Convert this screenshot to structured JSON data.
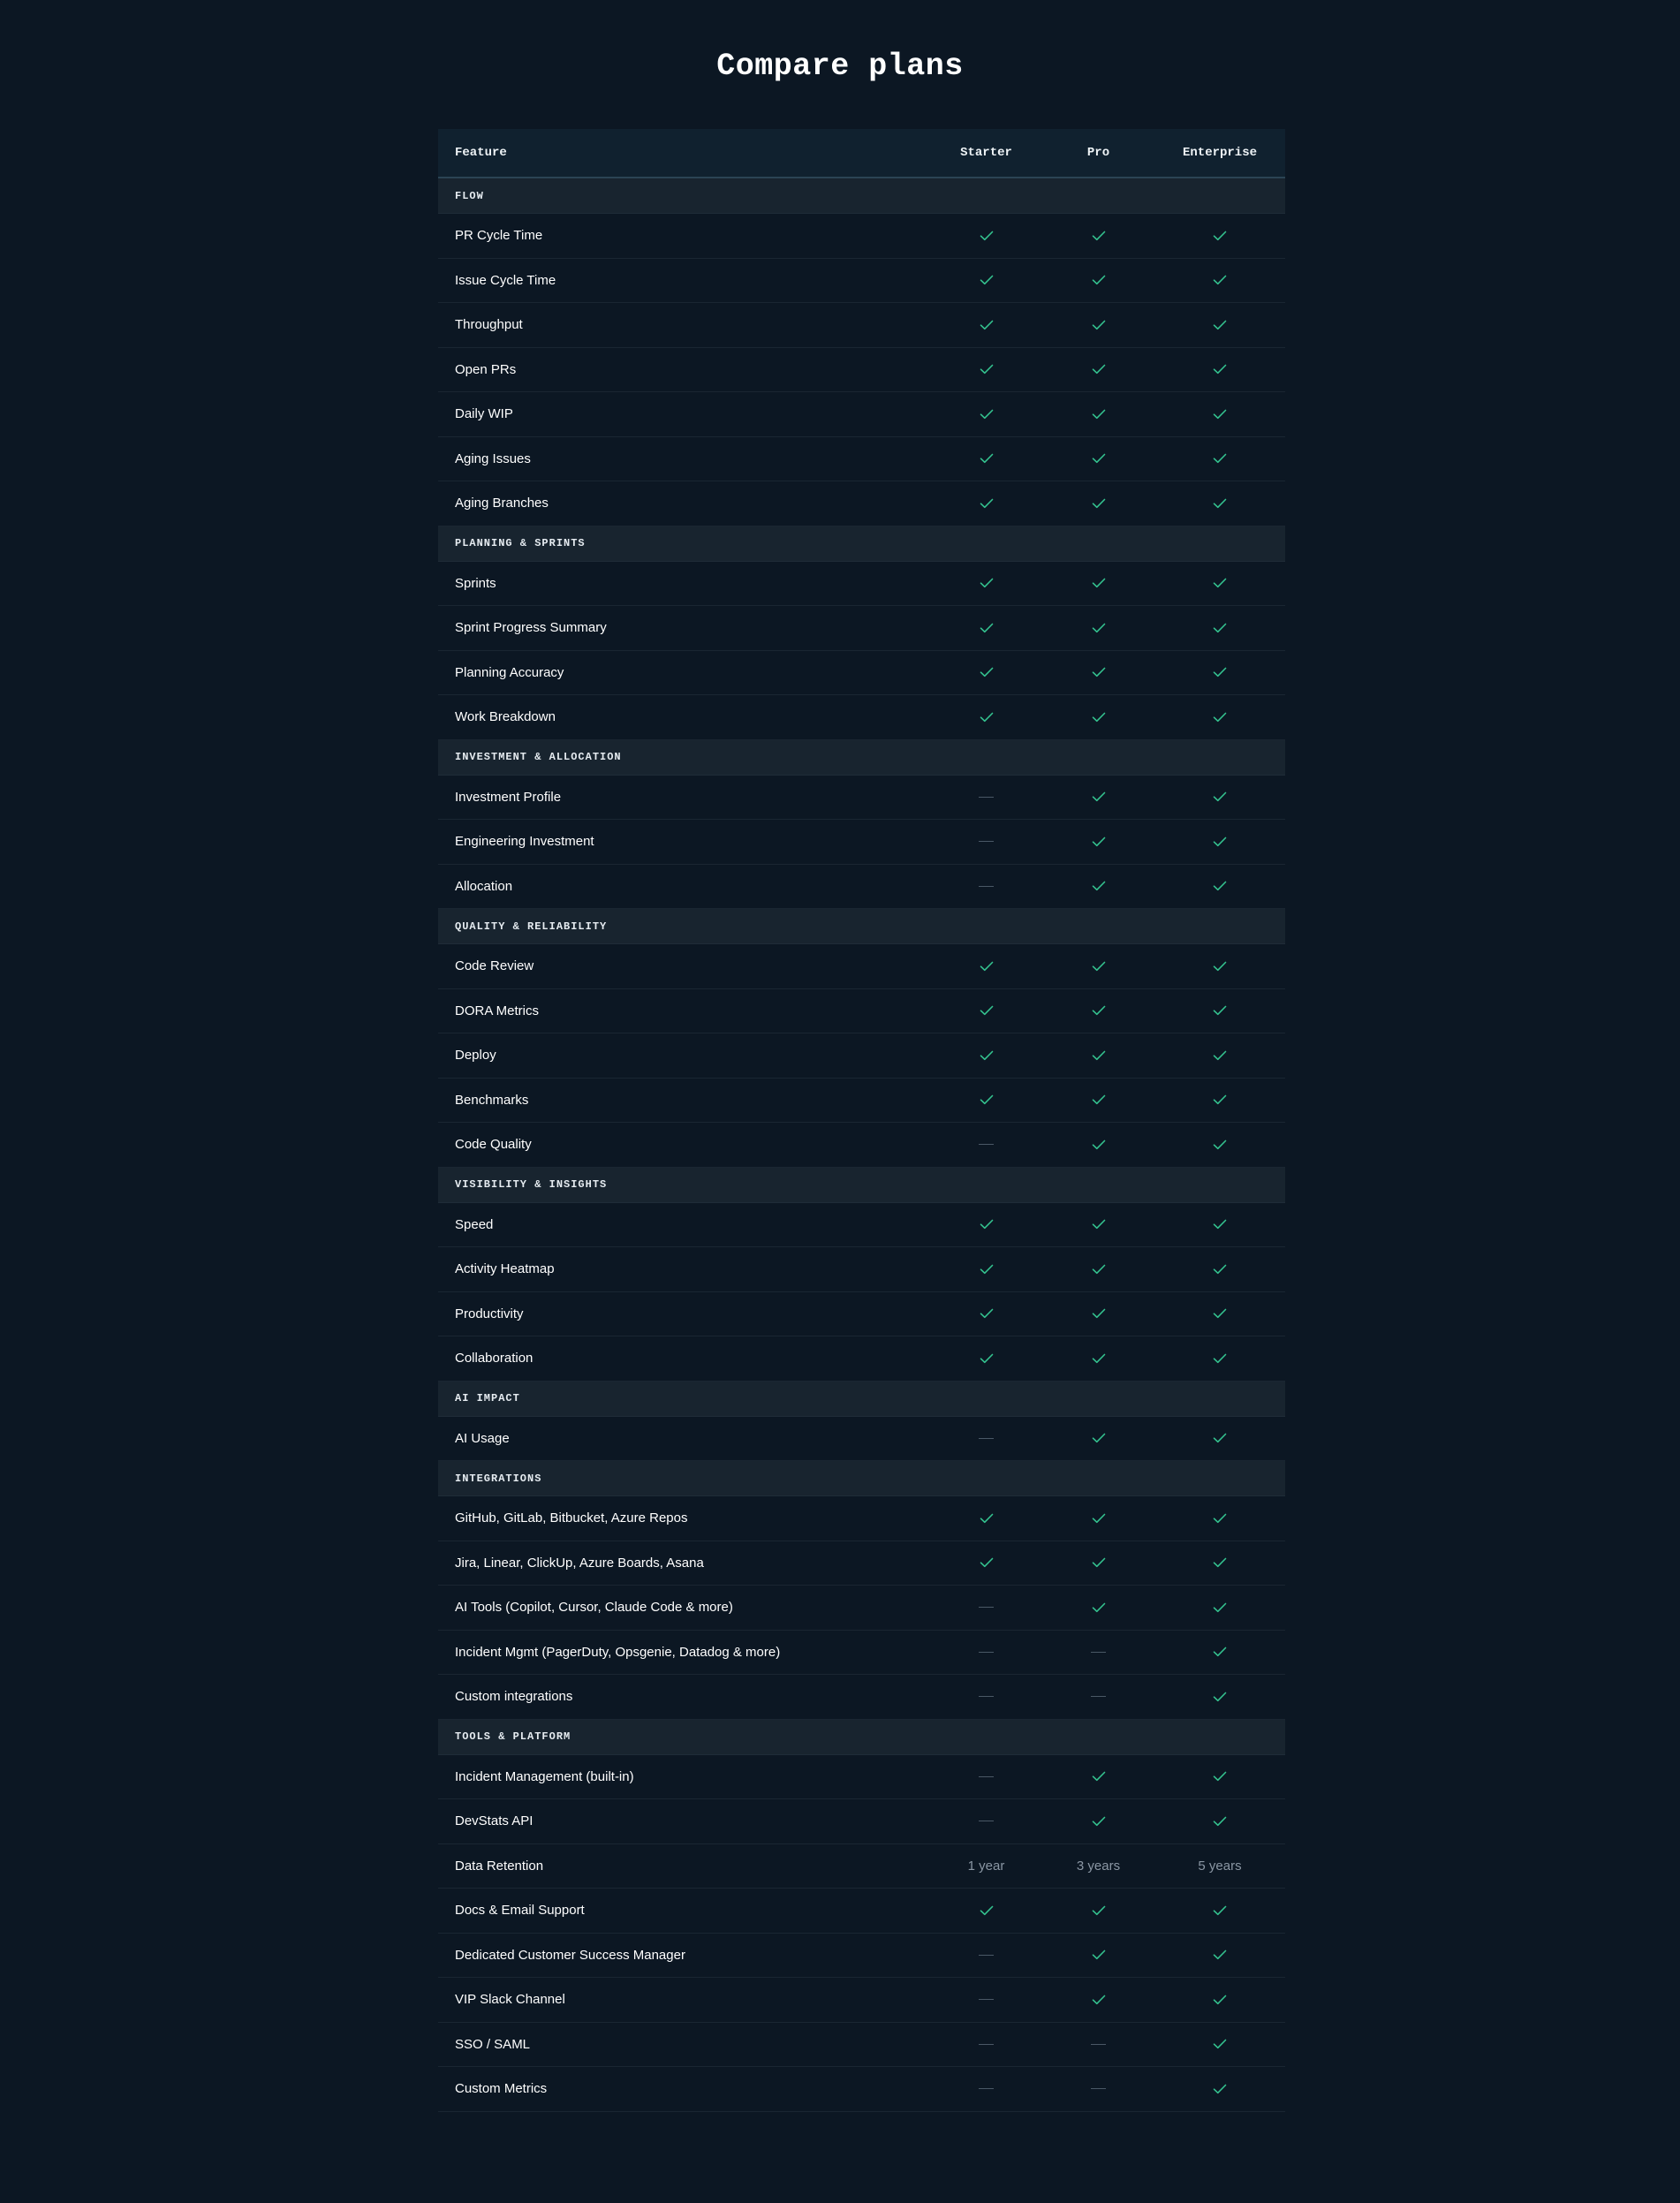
{
  "title": "Compare plans",
  "colors": {
    "background": "#0c1723",
    "header_bg": "#10212f",
    "section_bg": "#18242f",
    "check": "#34c28f",
    "dash": "#4a5866",
    "muted_text": "#8a96a3"
  },
  "columns": [
    "Feature",
    "Starter",
    "Pro",
    "Enterprise"
  ],
  "sections": [
    {
      "name": "FLOW",
      "rows": [
        {
          "feature": "PR Cycle Time",
          "values": [
            "check",
            "check",
            "check"
          ]
        },
        {
          "feature": "Issue Cycle Time",
          "values": [
            "check",
            "check",
            "check"
          ]
        },
        {
          "feature": "Throughput",
          "values": [
            "check",
            "check",
            "check"
          ]
        },
        {
          "feature": "Open PRs",
          "values": [
            "check",
            "check",
            "check"
          ]
        },
        {
          "feature": "Daily WIP",
          "values": [
            "check",
            "check",
            "check"
          ]
        },
        {
          "feature": "Aging Issues",
          "values": [
            "check",
            "check",
            "check"
          ]
        },
        {
          "feature": "Aging Branches",
          "values": [
            "check",
            "check",
            "check"
          ]
        }
      ]
    },
    {
      "name": "PLANNING & SPRINTS",
      "rows": [
        {
          "feature": "Sprints",
          "values": [
            "check",
            "check",
            "check"
          ]
        },
        {
          "feature": "Sprint Progress Summary",
          "values": [
            "check",
            "check",
            "check"
          ]
        },
        {
          "feature": "Planning Accuracy",
          "values": [
            "check",
            "check",
            "check"
          ]
        },
        {
          "feature": "Work Breakdown",
          "values": [
            "check",
            "check",
            "check"
          ]
        }
      ]
    },
    {
      "name": "INVESTMENT & ALLOCATION",
      "rows": [
        {
          "feature": "Investment Profile",
          "values": [
            "dash",
            "check",
            "check"
          ]
        },
        {
          "feature": "Engineering Investment",
          "values": [
            "dash",
            "check",
            "check"
          ]
        },
        {
          "feature": "Allocation",
          "values": [
            "dash",
            "check",
            "check"
          ]
        }
      ]
    },
    {
      "name": "QUALITY & RELIABILITY",
      "rows": [
        {
          "feature": "Code Review",
          "values": [
            "check",
            "check",
            "check"
          ]
        },
        {
          "feature": "DORA Metrics",
          "values": [
            "check",
            "check",
            "check"
          ]
        },
        {
          "feature": "Deploy",
          "values": [
            "check",
            "check",
            "check"
          ]
        },
        {
          "feature": "Benchmarks",
          "values": [
            "check",
            "check",
            "check"
          ]
        },
        {
          "feature": "Code Quality",
          "values": [
            "dash",
            "check",
            "check"
          ]
        }
      ]
    },
    {
      "name": "VISIBILITY & INSIGHTS",
      "rows": [
        {
          "feature": "Speed",
          "values": [
            "check",
            "check",
            "check"
          ]
        },
        {
          "feature": "Activity Heatmap",
          "values": [
            "check",
            "check",
            "check"
          ]
        },
        {
          "feature": "Productivity",
          "values": [
            "check",
            "check",
            "check"
          ]
        },
        {
          "feature": "Collaboration",
          "values": [
            "check",
            "check",
            "check"
          ]
        }
      ]
    },
    {
      "name": "AI IMPACT",
      "rows": [
        {
          "feature": "AI Usage",
          "values": [
            "dash",
            "check",
            "check"
          ]
        }
      ]
    },
    {
      "name": "INTEGRATIONS",
      "rows": [
        {
          "feature": "GitHub, GitLab, Bitbucket, Azure Repos",
          "values": [
            "check",
            "check",
            "check"
          ]
        },
        {
          "feature": "Jira, Linear, ClickUp, Azure Boards, Asana",
          "values": [
            "check",
            "check",
            "check"
          ]
        },
        {
          "feature": "AI Tools (Copilot, Cursor, Claude Code & more)",
          "values": [
            "dash",
            "check",
            "check"
          ]
        },
        {
          "feature": "Incident Mgmt (PagerDuty, Opsgenie, Datadog & more)",
          "values": [
            "dash",
            "dash",
            "check"
          ]
        },
        {
          "feature": "Custom integrations",
          "values": [
            "dash",
            "dash",
            "check"
          ]
        }
      ]
    },
    {
      "name": "TOOLS & PLATFORM",
      "rows": [
        {
          "feature": "Incident Management (built-in)",
          "values": [
            "dash",
            "check",
            "check"
          ]
        },
        {
          "feature": "DevStats API",
          "values": [
            "dash",
            "check",
            "check"
          ]
        },
        {
          "feature": "Data Retention",
          "values": [
            "1 year",
            "3 years",
            "5 years"
          ]
        },
        {
          "feature": "Docs & Email Support",
          "values": [
            "check",
            "check",
            "check"
          ]
        },
        {
          "feature": "Dedicated Customer Success Manager",
          "values": [
            "dash",
            "check",
            "check"
          ]
        },
        {
          "feature": "VIP Slack Channel",
          "values": [
            "dash",
            "check",
            "check"
          ]
        },
        {
          "feature": "SSO / SAML",
          "values": [
            "dash",
            "dash",
            "check"
          ]
        },
        {
          "feature": "Custom Metrics",
          "values": [
            "dash",
            "dash",
            "check"
          ]
        }
      ]
    }
  ]
}
